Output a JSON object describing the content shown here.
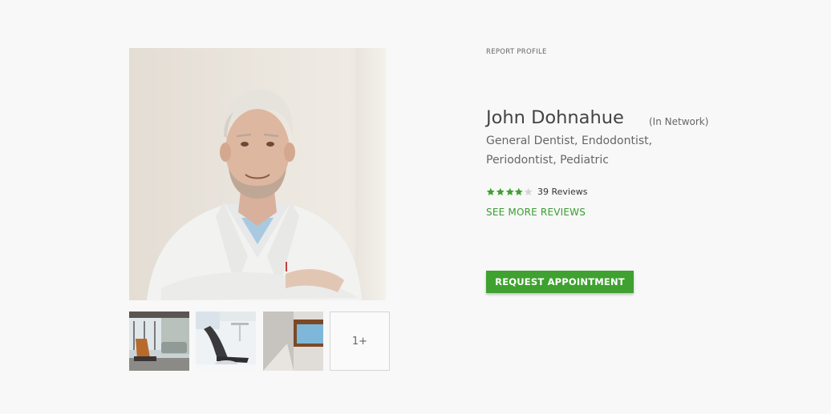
{
  "report_link": "REPORT PROFILE",
  "doctor": {
    "name": "John Dohnahue",
    "network_status": "(In Network)",
    "specialties": "General Dentist, Endodontist, Periodontist, Pediatric",
    "rating": 4,
    "rating_max": 5,
    "reviews_label": "39 Reviews"
  },
  "see_more_reviews": "SEE MORE REVIEWS",
  "request_button": "REQUEST APPOINTMENT",
  "gallery": {
    "more_label": "1+"
  },
  "colors": {
    "accent": "#3fa130",
    "link": "#3a9c31",
    "star_filled": "#3fa130",
    "star_empty": "#d5d5d5"
  }
}
